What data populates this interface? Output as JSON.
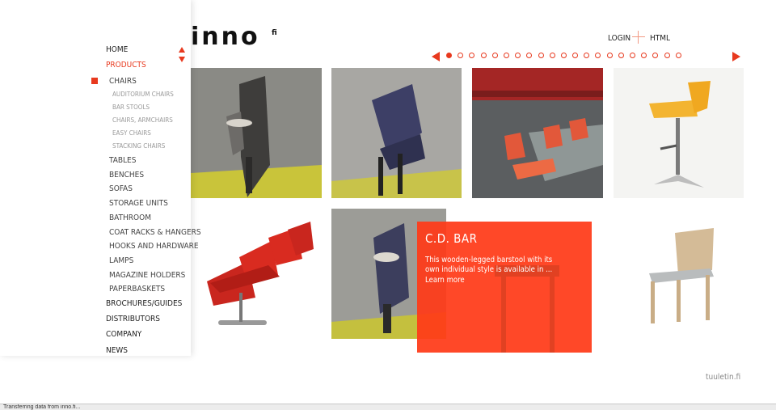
{
  "brand": {
    "logo_text": "inno",
    "logo_sup": "fi"
  },
  "header": {
    "login_label": "LOGIN",
    "html_label": "HTML"
  },
  "pager": {
    "total_dots": 21,
    "active_index": 0
  },
  "nav": {
    "home": "HOME",
    "products": "PRODUCTS",
    "chairs": "CHAIRS",
    "chair_subs": [
      "AUDITORIUM CHAIRS",
      "BAR STOOLS",
      "CHAIRS, ARMCHAIRS",
      "EASY CHAIRS",
      "STACKING CHAIRS"
    ],
    "categories": [
      "TABLES",
      "BENCHES",
      "SOFAS",
      "STORAGE UNITS",
      "BATHROOM",
      "COAT RACKS & HANGERS",
      "HOOKS AND HARDWARE",
      "LAMPS",
      "MAGAZINE HOLDERS",
      "PAPERBASKETS"
    ],
    "bottom": [
      "BROCHURES/GUIDES",
      "DISTRIBUTORS",
      "COMPANY",
      "NEWS"
    ]
  },
  "featured": {
    "title": "C.D. BAR",
    "description": "This wooden-legged barstool with its own individual style is available in ...",
    "more_label": "Learn more"
  },
  "footer": {
    "credit": "tuuletin.fi"
  },
  "status_bar": {
    "text": "Transferring data from inno.fi..."
  },
  "colors": {
    "accent": "#e8391e",
    "overlay": "#ff3a18"
  }
}
